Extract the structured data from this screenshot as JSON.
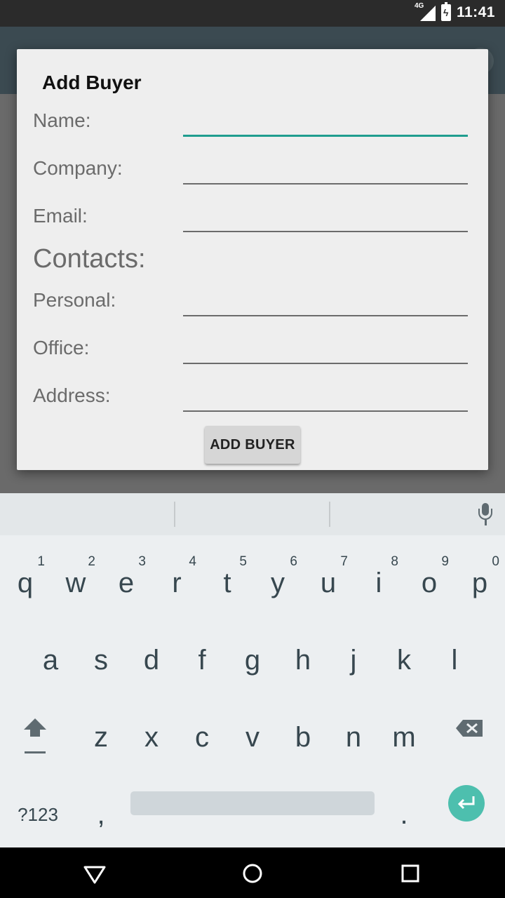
{
  "status": {
    "network": "4G",
    "time": "11:41"
  },
  "dialog": {
    "title": "Add Buyer",
    "name_label": "Name:",
    "company_label": "Company:",
    "email_label": "Email:",
    "contacts_heading": "Contacts:",
    "personal_label": "Personal:",
    "office_label": "Office:",
    "address_label": "Address:",
    "add_button": "ADD BUYER",
    "fields": {
      "name": "",
      "company": "",
      "email": "",
      "personal": "",
      "office": "",
      "address": ""
    }
  },
  "keyboard": {
    "row1": [
      {
        "ch": "q",
        "num": "1"
      },
      {
        "ch": "w",
        "num": "2"
      },
      {
        "ch": "e",
        "num": "3"
      },
      {
        "ch": "r",
        "num": "4"
      },
      {
        "ch": "t",
        "num": "5"
      },
      {
        "ch": "y",
        "num": "6"
      },
      {
        "ch": "u",
        "num": "7"
      },
      {
        "ch": "i",
        "num": "8"
      },
      {
        "ch": "o",
        "num": "9"
      },
      {
        "ch": "p",
        "num": "0"
      }
    ],
    "row2": [
      "a",
      "s",
      "d",
      "f",
      "g",
      "h",
      "j",
      "k",
      "l"
    ],
    "row3": [
      "z",
      "x",
      "c",
      "v",
      "b",
      "n",
      "m"
    ],
    "symbols_key": "?123",
    "comma_key": ",",
    "period_key": "."
  },
  "colors": {
    "accent": "#1f9d8f",
    "enter_key": "#4dbfae",
    "app_bar": "#3b4a51"
  }
}
